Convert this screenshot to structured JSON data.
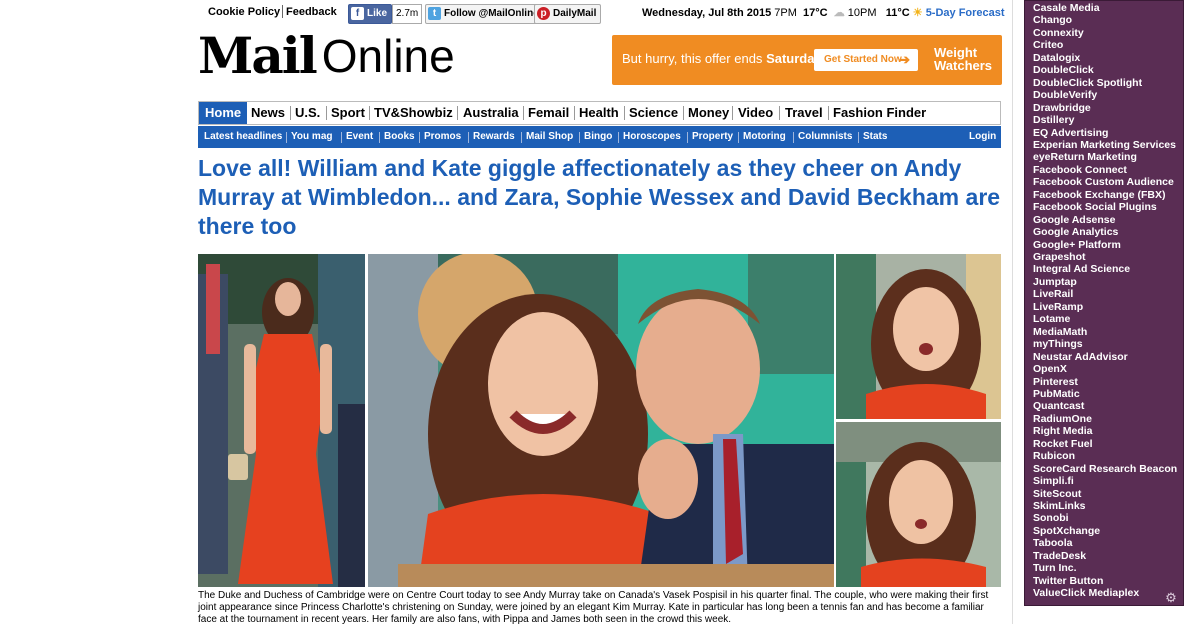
{
  "topbar": {
    "cookie_policy": "Cookie Policy",
    "feedback": "Feedback",
    "fb_like": "Like",
    "fb_count": "2.7m",
    "twitter_follow": "Follow @MailOnline",
    "pinterest": "DailyMail",
    "date": "Wednesday, Jul 8th 2015",
    "time_now": "7PM",
    "temp_now": "17°C",
    "time_later": "10PM",
    "temp_later": "11°C",
    "forecast_link": "5-Day Forecast"
  },
  "logo": {
    "mail": "Mail",
    "online": "Online"
  },
  "ad": {
    "text_prefix": "But hurry, this offer ends",
    "text_bold": "Saturday",
    "button": "Get Started Now",
    "brand_line1": "Weight",
    "brand_line2": "Watchers"
  },
  "nav": {
    "items": [
      "Home",
      "News",
      "U.S.",
      "Sport",
      "TV&Showbiz",
      "Australia",
      "Femail",
      "Health",
      "Science",
      "Money",
      "Video",
      "Travel",
      "Fashion Finder"
    ]
  },
  "subnav": {
    "items": [
      "Latest headlines",
      "You mag",
      "Event",
      "Books",
      "Promos",
      "Rewards",
      "Mail Shop",
      "Bingo",
      "Horoscopes",
      "Property",
      "Motoring",
      "Columnists",
      "Stats"
    ],
    "login": "Login"
  },
  "article": {
    "headline": "Love all! William and Kate giggle affectionately as they cheer on Andy Murray at Wimbledon... and Zara, Sophie Wessex and David Beckham are there too",
    "caption": "The Duke and Duchess of Cambridge were on Centre Court today to see Andy Murray take on Canada's Vasek Pospisil in his quarter final. The couple, who were making their first joint appearance since Princess Charlotte's christening on Sunday, were joined by an elegant Kim Murray. Kate in particular has long been a tennis fan and has become a familiar face at the tournament in recent years. Her family are also fans, with Pippa and James both seen in the crowd this week."
  },
  "tracker_panel": {
    "items": [
      "Casale Media",
      "Chango",
      "Connexity",
      "Criteo",
      "Datalogix",
      "DoubleClick",
      "DoubleClick Spotlight",
      "DoubleVerify",
      "Drawbridge",
      "Dstillery",
      "EQ Advertising",
      "Experian Marketing Services",
      "eyeReturn Marketing",
      "Facebook Connect",
      "Facebook Custom Audience",
      "Facebook Exchange (FBX)",
      "Facebook Social Plugins",
      "Google Adsense",
      "Google Analytics",
      "Google+ Platform",
      "Grapeshot",
      "Integral Ad Science",
      "Jumptap",
      "LiveRail",
      "LiveRamp",
      "Lotame",
      "MediaMath",
      "myThings",
      "Neustar AdAdvisor",
      "OpenX",
      "Pinterest",
      "PubMatic",
      "Quantcast",
      "RadiumOne",
      "Right Media",
      "Rocket Fuel",
      "Rubicon",
      "ScoreCard Research Beacon",
      "Simpli.fi",
      "SiteScout",
      "SkimLinks",
      "Sonobi",
      "SpotXchange",
      "Taboola",
      "TradeDesk",
      "Turn Inc.",
      "Twitter Button",
      "ValueClick Mediaplex"
    ]
  },
  "colors": {
    "brand_blue": "#1d5fb6",
    "panel_purple": "#5a2d54",
    "ad_orange": "#f08c22"
  },
  "icons": [
    "facebook-icon",
    "twitter-icon",
    "pinterest-icon",
    "weather-icon",
    "arrow-right-icon",
    "gear-icon"
  ]
}
